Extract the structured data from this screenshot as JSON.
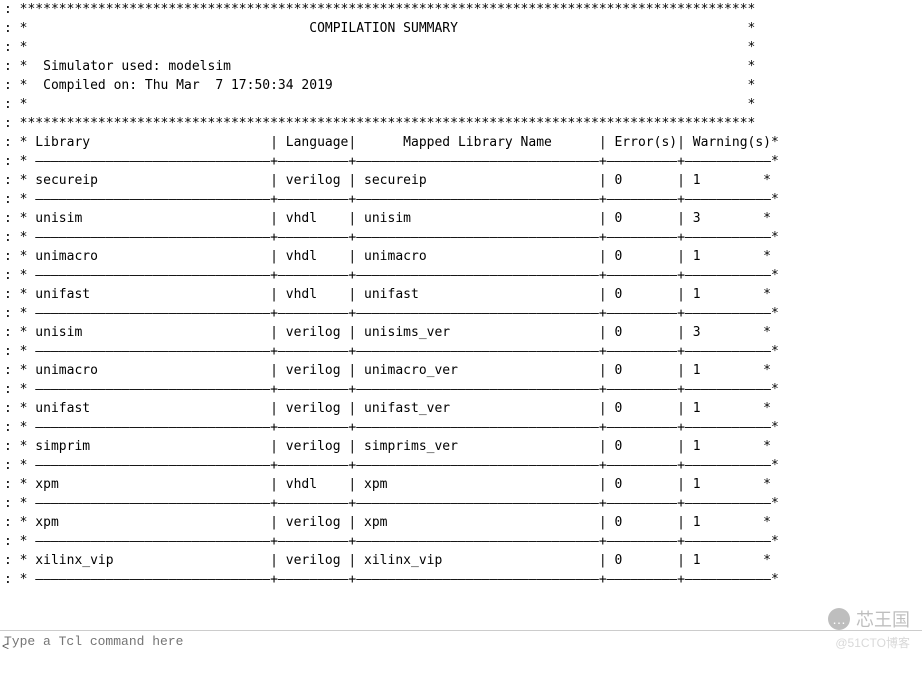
{
  "title": "COMPILATION SUMMARY",
  "meta_lines": [
    "Simulator used: modelsim",
    "Compiled on: Thu Mar  7 17:50:34 2019"
  ],
  "headers": {
    "library": "Library",
    "language": "Language",
    "mapped": "Mapped Library Name",
    "errors": "Error(s)",
    "warnings": "Warning(s)"
  },
  "rows": [
    {
      "library": "secureip",
      "language": "verilog",
      "mapped": "secureip",
      "errors": "0",
      "warnings": "1"
    },
    {
      "library": "unisim",
      "language": "vhdl",
      "mapped": "unisim",
      "errors": "0",
      "warnings": "3"
    },
    {
      "library": "unimacro",
      "language": "vhdl",
      "mapped": "unimacro",
      "errors": "0",
      "warnings": "1"
    },
    {
      "library": "unifast",
      "language": "vhdl",
      "mapped": "unifast",
      "errors": "0",
      "warnings": "1"
    },
    {
      "library": "unisim",
      "language": "verilog",
      "mapped": "unisims_ver",
      "errors": "0",
      "warnings": "3"
    },
    {
      "library": "unimacro",
      "language": "verilog",
      "mapped": "unimacro_ver",
      "errors": "0",
      "warnings": "1"
    },
    {
      "library": "unifast",
      "language": "verilog",
      "mapped": "unifast_ver",
      "errors": "0",
      "warnings": "1"
    },
    {
      "library": "simprim",
      "language": "verilog",
      "mapped": "simprims_ver",
      "errors": "0",
      "warnings": "1"
    },
    {
      "library": "xpm",
      "language": "vhdl",
      "mapped": "xpm",
      "errors": "0",
      "warnings": "1"
    },
    {
      "library": "xpm",
      "language": "verilog",
      "mapped": "xpm",
      "errors": "0",
      "warnings": "1"
    },
    {
      "library": "xilinx_vip",
      "language": "verilog",
      "mapped": "xilinx_vip",
      "errors": "0",
      "warnings": "1"
    }
  ],
  "tcl_placeholder": "Type a Tcl command here",
  "watermark": {
    "main": "芯王国",
    "sub": "@51CTO博客"
  }
}
